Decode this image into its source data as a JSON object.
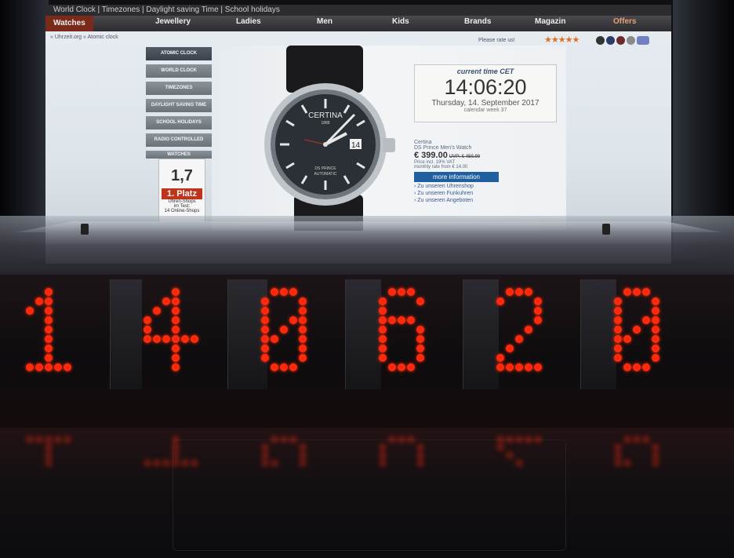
{
  "topbar_text": "World Clock | Timezones | Daylight saving Time | School holidays",
  "nav": [
    "Watches",
    "Jewellery",
    "Ladies",
    "Men",
    "Kids",
    "Brands",
    "Magazin",
    "Offers"
  ],
  "breadcrumb": "» Uhrzeit.org » Atomic clock",
  "rate_text": "Please rate us!",
  "stars": "★★★★★",
  "menu": [
    "ATOMIC CLOCK",
    "WORLD CLOCK",
    "TIMEZONES",
    "DAYLIGHT SAVING TIME",
    "SCHOOL HOLIDAYS",
    "RADIO CONTROLLED",
    "WATCHES"
  ],
  "rating": {
    "value": "1,7",
    "platz": "1. Platz",
    "line1": "Uhren-Shops",
    "line2": "im Test:",
    "line3": "14 Online-Shops"
  },
  "watch": {
    "brand_dial": "CERTINA",
    "year_dial": "1888",
    "model_dial": "DS PRINCE",
    "type_dial": "AUTOMATIC",
    "date_dial": "14"
  },
  "timebox": {
    "label": "current time CET",
    "time": "14:06:20",
    "date": "Thursday, 14. September 2017",
    "week": "calendar week 37"
  },
  "product": {
    "brand": "Certina",
    "name": "DS Prince Men's Watch",
    "price": "€ 399.00",
    "uvp": "UVP: € 450.00",
    "savings": "Price incl. 19% VAT",
    "monthly": "monthly rate from € 14.00",
    "button": "more information",
    "links": [
      "Zu unseren Uhrenshop",
      "Zu unseren Funkuhren",
      "Zu unseren Angeboten"
    ]
  },
  "led_display": {
    "digits": [
      "1",
      "4",
      "0",
      "6",
      "2",
      "0"
    ],
    "color": "#ff2a10"
  },
  "colors": {
    "nav_bg": "#2d2d31",
    "active_tab": "#7a2a1a",
    "menu_btn": "#6a727a",
    "platz_red": "#c0341c",
    "link_blue": "#1f5fa0",
    "led_glow": "#ff3a18"
  }
}
